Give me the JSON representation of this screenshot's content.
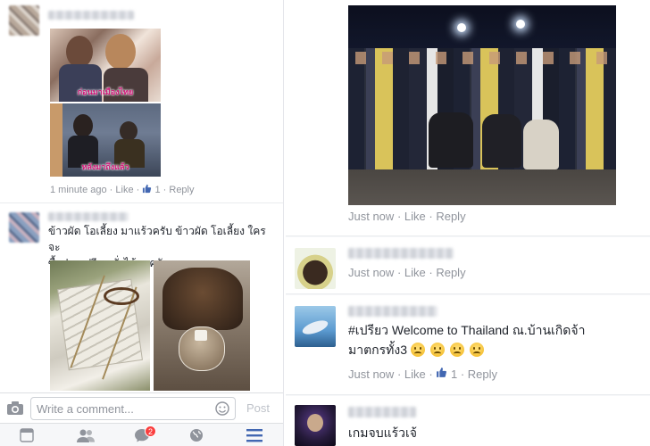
{
  "left": {
    "comment1": {
      "photo1_caption": "ก่อนมาเมืองไทย",
      "photo2_caption": "หลังมาถึงแล้ว",
      "time": "1 minute ago",
      "like": "Like",
      "like_count": "1",
      "reply": "Reply"
    },
    "comment2": {
      "text_line1": "ข้าวผัด โอเลี้ยง มาแร้วครับ ข้าวผัด โอเลี้ยง ใครจะ",
      "text_line2": "ซื้อฝากเปรียว สั่งได้นะครับ"
    },
    "composer": {
      "placeholder": "Write a comment...",
      "post": "Post"
    },
    "tabbar": {
      "messages_badge": "2"
    }
  },
  "right": {
    "photo_post": {
      "time": "Just now",
      "like": "Like",
      "reply": "Reply"
    },
    "comment_a": {
      "time": "Just now",
      "like": "Like",
      "reply": "Reply"
    },
    "comment_b": {
      "text_line1": "#เปรียว Welcome to Thailand ณ.บ้านเกิดจ้า",
      "text_line2": "มาตกรทั้ง3",
      "time": "Just now",
      "like": "Like",
      "like_count": "1",
      "reply": "Reply"
    },
    "comment_c": {
      "text": "เกมจบแร้วเจ้"
    }
  },
  "colors": {
    "facebook_blue": "#4267b2",
    "meta_gray": "#90949c",
    "badge_red": "#fa3e3e"
  }
}
